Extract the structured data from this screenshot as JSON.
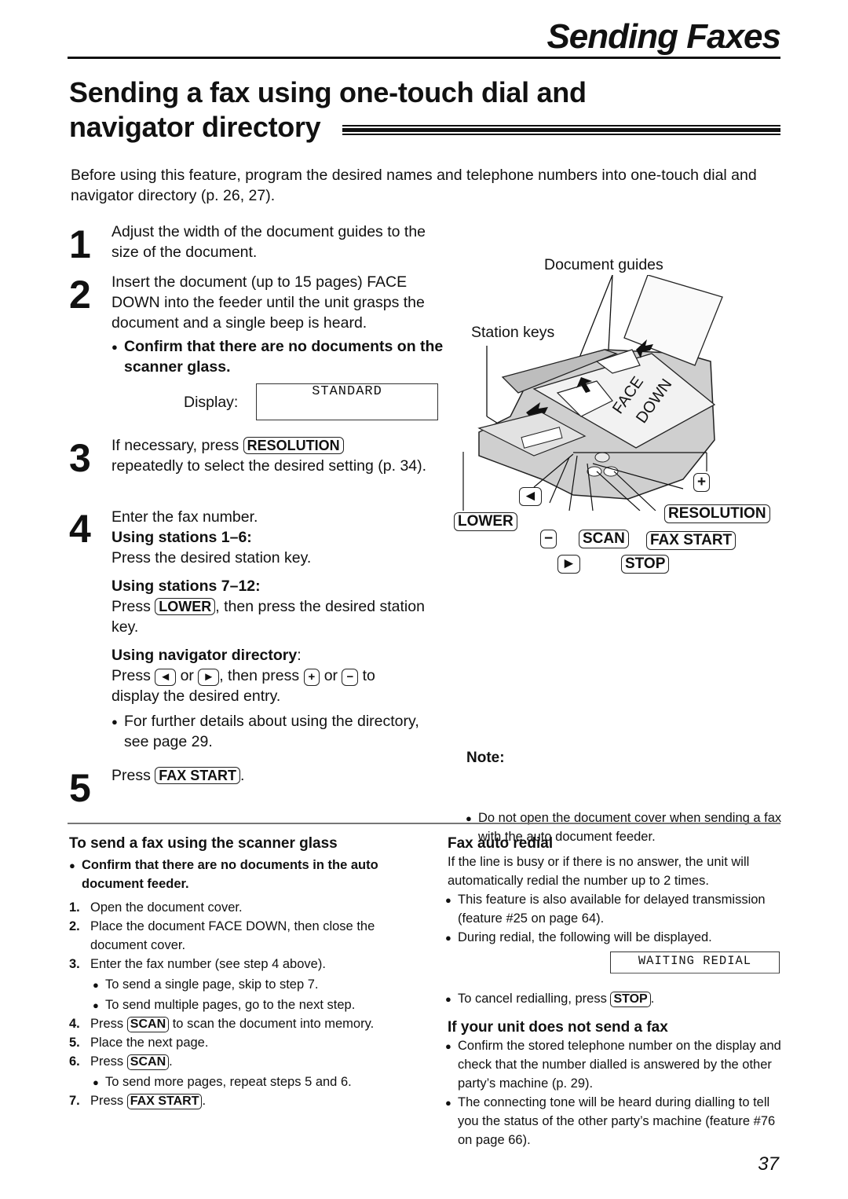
{
  "header": {
    "running_head": "Sending Faxes",
    "title_line1": "Sending a fax using one-touch dial and",
    "title_line2": "navigator directory"
  },
  "intro": "Before using this feature, program the desired names and telephone numbers into one-touch dial and navigator directory (p. 26, 27).",
  "steps": {
    "s1": {
      "num": "1",
      "text": "Adjust the width of the document guides to the size of the document."
    },
    "s2": {
      "num": "2",
      "text": "Insert the document (up to 15 pages) FACE DOWN into the feeder until the unit grasps the document and a single beep is heard.",
      "bullet": "Confirm that there are no documents on the scanner glass.",
      "display_label": "Display:",
      "display_value": "STANDARD"
    },
    "s3": {
      "num": "3",
      "pre": "If necessary, press",
      "key": "RESOLUTION",
      "post": "repeatedly to select the desired setting (p. 34)."
    },
    "s4": {
      "num": "4",
      "text": "Enter the fax number.",
      "sub1_head": "Using stations 1–6:",
      "sub1_text": "Press the desired station key.",
      "sub2_head": "Using stations 7–12:",
      "sub2_pre": "Press",
      "sub2_key": "LOWER",
      "sub2_post": ", then press the desired station key.",
      "sub3_head": "Using navigator directory",
      "sub3_colon": ":",
      "sub3_press": "Press",
      "sub3_or1": "or",
      "sub3_then": ", then press",
      "sub3_or2": "or",
      "sub3_to": "to",
      "sub3_line2": "display the desired entry.",
      "key_left": "◄",
      "key_right": "►",
      "key_plus": "+",
      "key_minus": "−",
      "bullet": "For further details about using the directory, see page 29."
    },
    "s5": {
      "num": "5",
      "pre": "Press",
      "key": "FAX START",
      "post": "."
    }
  },
  "illustration": {
    "label_document_guides": "Document guides",
    "label_station_keys": "Station keys",
    "paper_text_face": "FACE",
    "paper_text_down": "DOWN",
    "keys": {
      "left": "◄",
      "plus": "+",
      "lower": "LOWER",
      "resolution": "RESOLUTION",
      "minus": "−",
      "scan": "SCAN",
      "fax_start": "FAX START",
      "right": "►",
      "stop": "STOP"
    }
  },
  "note": {
    "title": "Note:",
    "bullet": "Do not open the document cover when sending a fax with the auto document feeder."
  },
  "scanner_glass": {
    "heading": "To send a fax using the scanner glass",
    "bullet": "Confirm that there are no documents in the auto document feeder.",
    "items": [
      {
        "n": "1.",
        "text": "Open the document cover."
      },
      {
        "n": "2.",
        "text": "Place the document FACE DOWN, then close the document cover."
      },
      {
        "n": "3.",
        "text": "Enter the fax number (see step 4 above)."
      },
      {
        "n": "4.",
        "pre": "Press",
        "key": "SCAN",
        "post": "to scan the document into memory."
      },
      {
        "n": "5.",
        "text": "Place the next page."
      },
      {
        "n": "6.",
        "pre": "Press",
        "key": "SCAN",
        "post": "."
      },
      {
        "n": "7.",
        "pre": "Press",
        "key": "FAX START",
        "post": "."
      }
    ],
    "sub_bullets_3": [
      "To send a single page, skip to step 7.",
      "To send multiple pages, go to the next step."
    ],
    "sub_bullet_6": "To send more pages, repeat steps 5 and 6."
  },
  "auto_redial": {
    "heading": "Fax auto redial",
    "text": "If the line is busy or if there is no answer, the unit will automatically redial the number up to 2 times.",
    "bullet1": "This feature is also available for delayed transmission (feature #25 on page 64).",
    "bullet2": "During redial, the following will be displayed.",
    "display_value": "WAITING REDIAL",
    "bullet3_pre": "To cancel redialling, press",
    "bullet3_key": "STOP",
    "bullet3_post": "."
  },
  "not_send": {
    "heading": "If your unit does not send a fax",
    "bullet1": "Confirm the stored telephone number on the display and check that the number dialled is answered by the other party’s machine (p. 29).",
    "bullet2": "The connecting tone will be heard during dialling to tell you the status of the other party’s machine (feature #76 on page 66)."
  },
  "page_number": "37"
}
